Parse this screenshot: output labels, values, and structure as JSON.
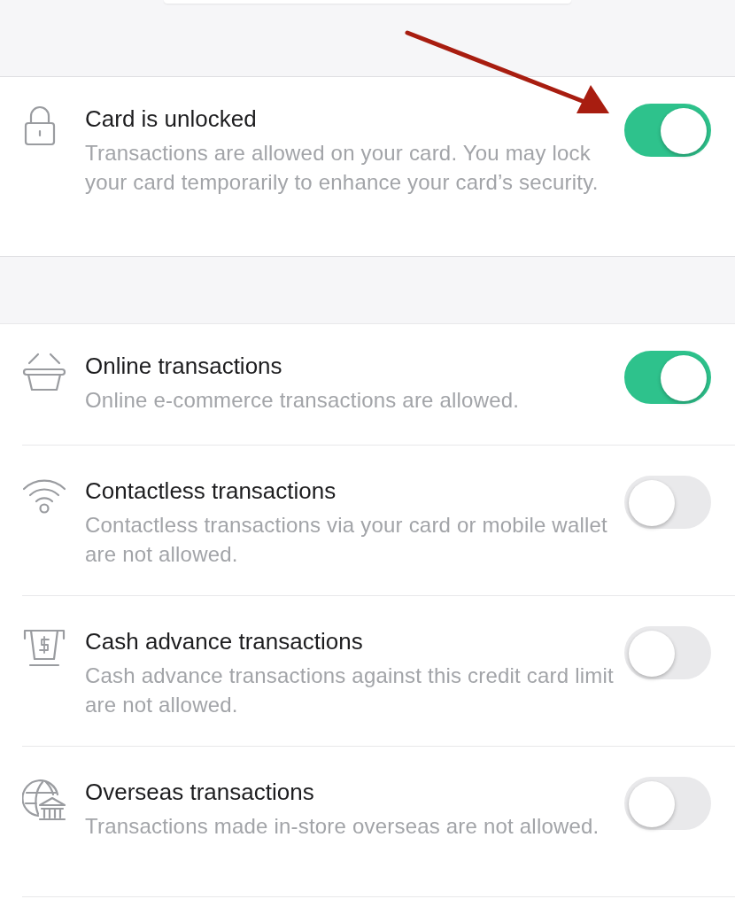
{
  "lock_section": {
    "kind": "lock",
    "title": "Card is unlocked",
    "description": "Transactions are allowed on your card. You may lock your card temporarily to enhance your card’s security.",
    "on": true
  },
  "transaction_settings": [
    {
      "kind": "basket",
      "title": "Online transactions",
      "description": "Online e-commerce transactions are allowed.",
      "on": true
    },
    {
      "kind": "wireless",
      "title": "Contactless transactions",
      "description": "Contactless transactions via your card or mobile wallet are not allowed.",
      "on": false
    },
    {
      "kind": "atm",
      "title": "Cash advance transactions",
      "description": "Cash advance transactions against this credit card limit are not allowed.",
      "on": false
    },
    {
      "kind": "globe",
      "title": "Overseas transactions",
      "description": "Transactions made in-store overseas are not allowed.",
      "on": false
    }
  ]
}
